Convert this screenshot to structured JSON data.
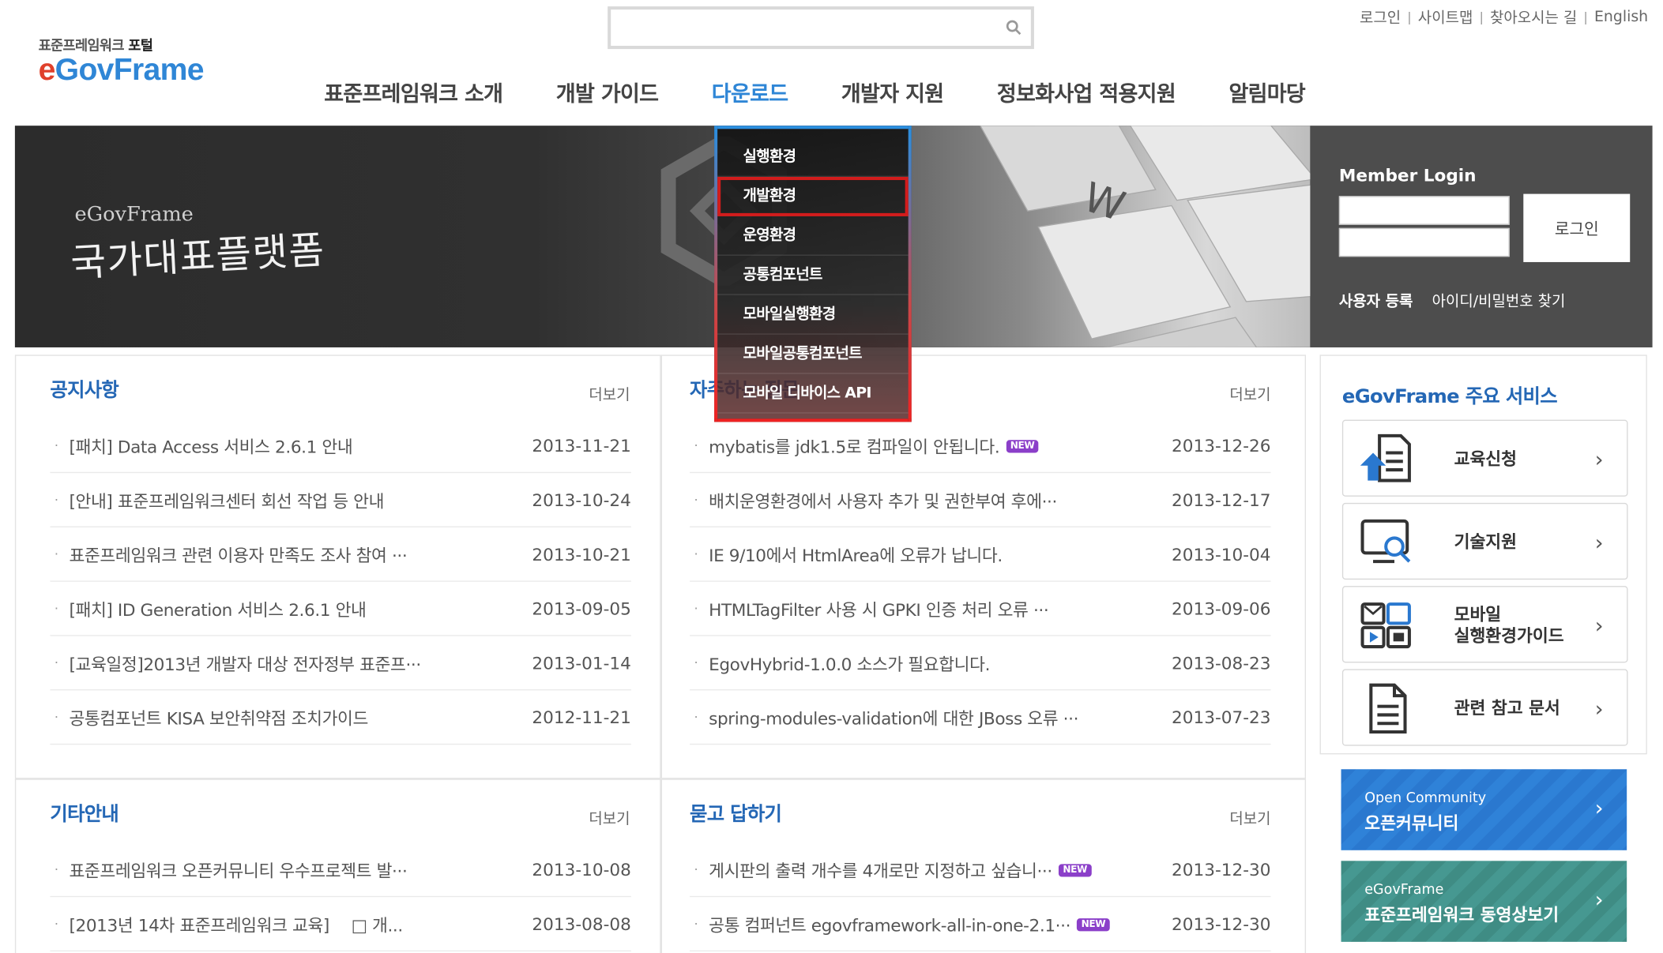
{
  "header": {
    "logo_sub_prefix": "표준프레임워크",
    "logo_sub_bold": "포털",
    "logo_e": "e",
    "logo_rest": "GovFrame",
    "search_placeholder": "",
    "toplinks": [
      "로그인",
      "사이트맵",
      "찾아오시는 길",
      "English"
    ],
    "separator": "|"
  },
  "nav": {
    "items": [
      "표준프레임워크 소개",
      "개발 가이드",
      "다운로드",
      "개발자 지원",
      "정보화사업 적용지원",
      "알림마당"
    ],
    "active_index": 2
  },
  "dropdown": {
    "items": [
      "실행환경",
      "개발환경",
      "운영환경",
      "공통컴포넌트",
      "모바일실행환경",
      "모바일공통컴포넌트",
      "모바일 디바이스 API"
    ],
    "selected_index": 1
  },
  "banner": {
    "tagline_en": "eGovFrame",
    "tagline_kr": "국가대표플랫폼"
  },
  "login": {
    "title": "Member Login",
    "button": "로그인",
    "register": "사용자 등록",
    "find": "아이디/비밀번호 찾기"
  },
  "notice": {
    "title": "공지사항",
    "more": "더보기",
    "items": [
      {
        "title": "[패치] Data Access 서비스 2.6.1 안내",
        "date": "2013-11-21"
      },
      {
        "title": "[안내] 표준프레임워크센터 회선 작업 등 안내",
        "date": "2013-10-24"
      },
      {
        "title": "표준프레임워크 관련 이용자 만족도 조사 참여 ···",
        "date": "2013-10-21"
      },
      {
        "title": "[패치] ID Generation 서비스 2.6.1 안내",
        "date": "2013-09-05"
      },
      {
        "title": "[교육일정]2013년 개발자 대상 전자정부 표준프···",
        "date": "2013-01-14"
      },
      {
        "title": "공통컴포넌트 KISA 보안취약점 조치가이드",
        "date": "2012-11-21"
      }
    ]
  },
  "faq": {
    "title": "자주하는 질문",
    "more": "더보기",
    "items": [
      {
        "title": "mybatis를 jdk1.5로 컴파일이 안됩니다.",
        "date": "2013-12-26",
        "new": true
      },
      {
        "title": "배치운영환경에서 사용자 추가 및 권한부여 후에···",
        "date": "2013-12-17",
        "new": false
      },
      {
        "title": "IE 9/10에서 HtmlArea에 오류가 납니다.",
        "date": "2013-10-04",
        "new": false
      },
      {
        "title": "HTMLTagFilter 사용 시 GPKI 인증 처리 오류 ···",
        "date": "2013-09-06",
        "new": false
      },
      {
        "title": "EgovHybrid-1.0.0 소스가 필요합니다.",
        "date": "2013-08-23",
        "new": false
      },
      {
        "title": "spring-modules-validation에 대한 JBoss 오류 ···",
        "date": "2013-07-23",
        "new": false
      }
    ]
  },
  "etc": {
    "title": "기타안내",
    "more": "더보기",
    "items": [
      {
        "title": "표준프레임워크 오픈커뮤니티 우수프로젝트 발···",
        "date": "2013-10-08"
      },
      {
        "title": "[2013년 14차 표준프레임워크 교육]　 □ 개...",
        "date": "2013-08-08"
      }
    ]
  },
  "qna": {
    "title": "묻고 답하기",
    "more": "더보기",
    "items": [
      {
        "title": "게시판의 출력 개수를 4개로만 지정하고 싶습니···",
        "date": "2013-12-30",
        "new": true
      },
      {
        "title": "공통 컴퍼넌트 egovframework-all-in-one-2.1···",
        "date": "2013-12-30",
        "new": true
      }
    ]
  },
  "new_badge": "NEW",
  "services": {
    "title": "eGovFrame 주요 서비스",
    "items": [
      {
        "label": "교육신청",
        "icon": "education-icon"
      },
      {
        "label": "기술지원",
        "icon": "tech-support-icon"
      },
      {
        "label": "모바일\n실행환경가이드",
        "icon": "mobile-guide-icon"
      },
      {
        "label": "관련 참고 문서",
        "icon": "document-icon"
      }
    ],
    "chevron": "›"
  },
  "promos": {
    "community_l1": "Open Community",
    "community_l2": "오픈커뮤니티",
    "video_l1": "eGovFrame",
    "video_l2": "표준프레임워크 동영상보기"
  },
  "colors": {
    "accent": "#2f86d6",
    "logo_red": "#e0402b",
    "heading_blue": "#2467b5",
    "new_badge": "#8b3fc9",
    "dropdown_highlight": "#d21c1c"
  }
}
